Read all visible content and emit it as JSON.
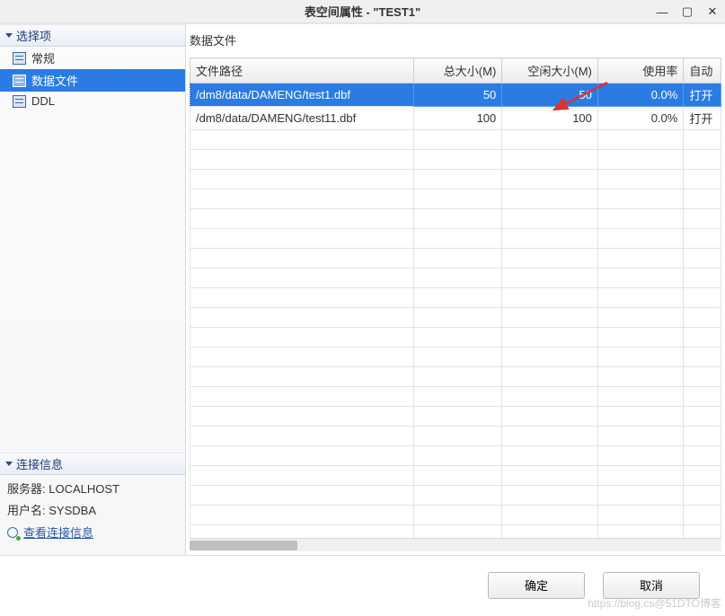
{
  "window": {
    "title": "表空间属性 - \"TEST1\""
  },
  "sidebar": {
    "options_header": "选择项",
    "items": [
      {
        "label": "常规"
      },
      {
        "label": "数据文件"
      },
      {
        "label": "DDL"
      }
    ],
    "conn_header": "连接信息",
    "server_label": "服务器:",
    "server_value": "LOCALHOST",
    "user_label": "用户名:",
    "user_value": "SYSDBA",
    "view_link": "查看连接信息"
  },
  "main": {
    "section_title": "数据文件",
    "columns": {
      "path": "文件路径",
      "total": "总大小(M)",
      "free": "空闲大小(M)",
      "usage": "使用率",
      "auto": "自动"
    },
    "rows": [
      {
        "path": "/dm8/data/DAMENG/test1.dbf",
        "total": "50",
        "free": "50",
        "usage": "0.0%",
        "auto": "打开"
      },
      {
        "path": "/dm8/data/DAMENG/test11.dbf",
        "total": "100",
        "free": "100",
        "usage": "0.0%",
        "auto": "打开"
      }
    ]
  },
  "footer": {
    "ok": "确定",
    "cancel": "取消"
  },
  "watermark": "https://blog.cs@51DTO博客"
}
